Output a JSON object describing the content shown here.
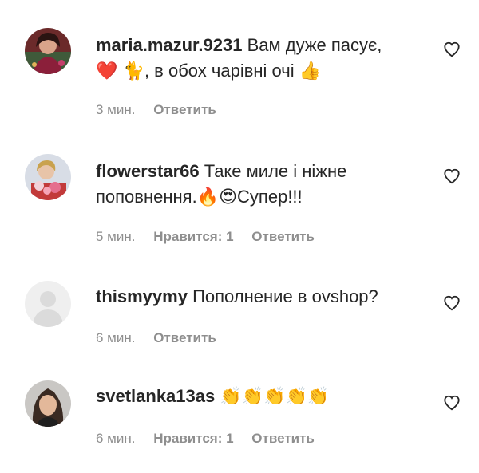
{
  "comments": [
    {
      "username": "maria.mazur.9231",
      "line1": "Вам дуже пасує,",
      "line2_emojis": [
        "❤️",
        "🐈"
      ],
      "line2_text": ", в обох чарівні очі",
      "line2_end_emoji": "👍",
      "time": "3 мин.",
      "reply": "Ответить",
      "avatar_icon": "user-avatar-photo"
    },
    {
      "username": "flowerstar66",
      "line1": "Таке миле і ніжне",
      "line2_text": "поповнення.",
      "line2_emojis": [
        "🔥",
        "😍"
      ],
      "line2_end_text": "Супер!!!",
      "time": "5 мин.",
      "likes": "Нравится: 1",
      "reply": "Ответить",
      "avatar_icon": "user-avatar-photo"
    },
    {
      "username": "thismyymy",
      "text": "Пополнение в ovshop?",
      "time": "6 мин.",
      "reply": "Ответить",
      "avatar_icon": "default-avatar-placeholder"
    },
    {
      "username": "svetlanka13as",
      "emojis": "👏👏👏👏👏",
      "time": "6 мин.",
      "likes": "Нравится: 1",
      "reply": "Ответить",
      "avatar_icon": "user-avatar-photo"
    }
  ],
  "icons": {
    "like": "heart-outline-icon"
  },
  "colors": {
    "text": "#262626",
    "secondary": "#8e8e8e",
    "background": "#ffffff"
  }
}
